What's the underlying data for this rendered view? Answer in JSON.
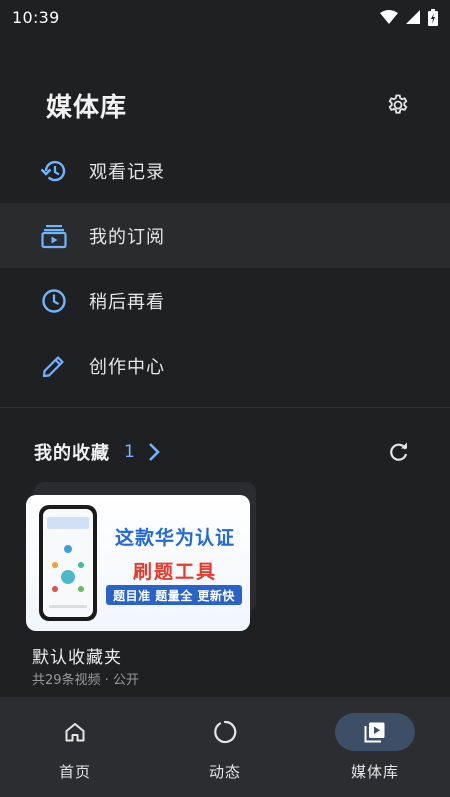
{
  "status_bar": {
    "time": "10:39"
  },
  "header": {
    "title": "媒体库"
  },
  "menu": {
    "items": [
      {
        "label": "观看记录",
        "icon": "history-icon"
      },
      {
        "label": "我的订阅",
        "icon": "subscriptions-icon"
      },
      {
        "label": "稍后再看",
        "icon": "clock-icon"
      },
      {
        "label": "创作中心",
        "icon": "pencil-icon"
      }
    ]
  },
  "favorites": {
    "title": "我的收藏",
    "count": "1",
    "folder": {
      "name": "默认收藏夹",
      "meta": "共29条视频 · 公开",
      "thumbnail": {
        "line1": "这款华为认证",
        "line2": "刷题工具",
        "banner": "题目准 题量全 更新快"
      }
    }
  },
  "bottom_nav": {
    "items": [
      {
        "label": "首页",
        "icon": "home-icon"
      },
      {
        "label": "动态",
        "icon": "dynamic-icon"
      },
      {
        "label": "媒体库",
        "icon": "library-icon"
      }
    ],
    "active": "媒体库"
  },
  "colors": {
    "accent": "#6fb5ff",
    "background": "#1f2022",
    "nav_active": "#3d4f66"
  }
}
